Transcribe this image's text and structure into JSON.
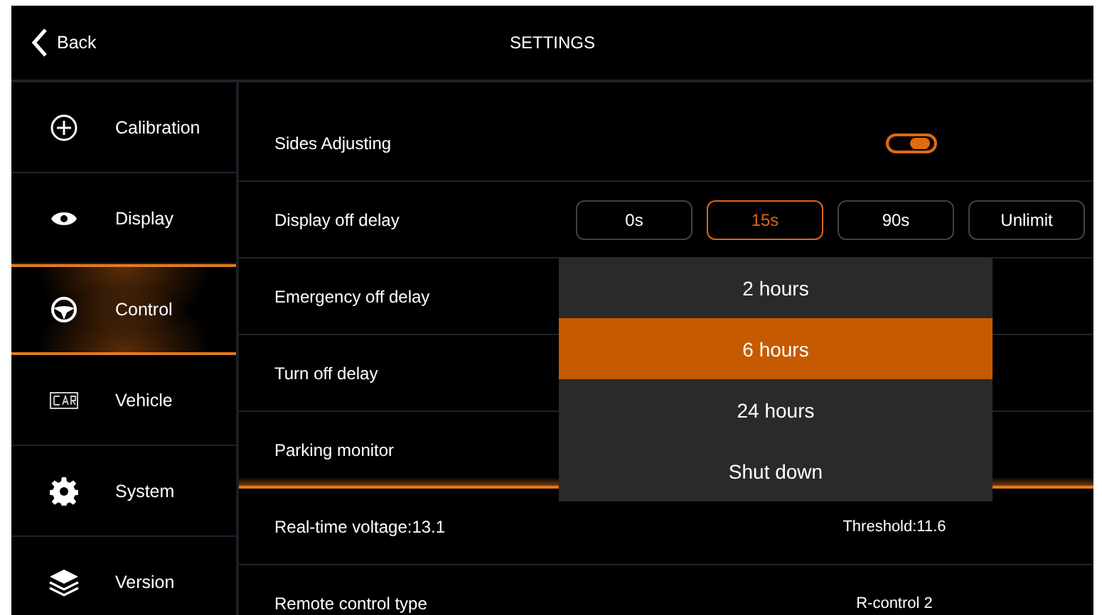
{
  "header": {
    "back_label": "Back",
    "title": "SETTINGS"
  },
  "sidebar": {
    "items": [
      {
        "label": "Calibration",
        "selected": false
      },
      {
        "label": "Display",
        "selected": false
      },
      {
        "label": "Control",
        "selected": true
      },
      {
        "label": "Vehicle",
        "selected": false
      },
      {
        "label": "System",
        "selected": false
      },
      {
        "label": "Version",
        "selected": false
      }
    ]
  },
  "rows": [
    {
      "label": "Sides Adjusting",
      "kind": "toggle",
      "on": true,
      "selected": false
    },
    {
      "label": "Display off delay",
      "kind": "options",
      "selected": false,
      "options": [
        {
          "label": "0s",
          "selected": false
        },
        {
          "label": "15s",
          "selected": true
        },
        {
          "label": "90s",
          "selected": false
        },
        {
          "label": "Unlimit",
          "selected": false
        }
      ]
    },
    {
      "label": "Emergency off delay",
      "kind": "plain",
      "selected": false
    },
    {
      "label": "Turn off delay",
      "kind": "plain",
      "selected": false
    },
    {
      "label": "Parking monitor",
      "kind": "plain",
      "selected": true
    },
    {
      "label": "Real-time voltage:13.1",
      "kind": "value",
      "value": "Threshold:11.6",
      "selected": false
    },
    {
      "label": "Remote control type",
      "kind": "value",
      "value": "R-control 2",
      "selected": false
    }
  ],
  "dropdown": {
    "options": [
      {
        "label": "2 hours",
        "selected": false
      },
      {
        "label": "6 hours",
        "selected": true
      },
      {
        "label": "24 hours",
        "selected": false
      },
      {
        "label": "Shut down",
        "selected": false
      }
    ]
  }
}
